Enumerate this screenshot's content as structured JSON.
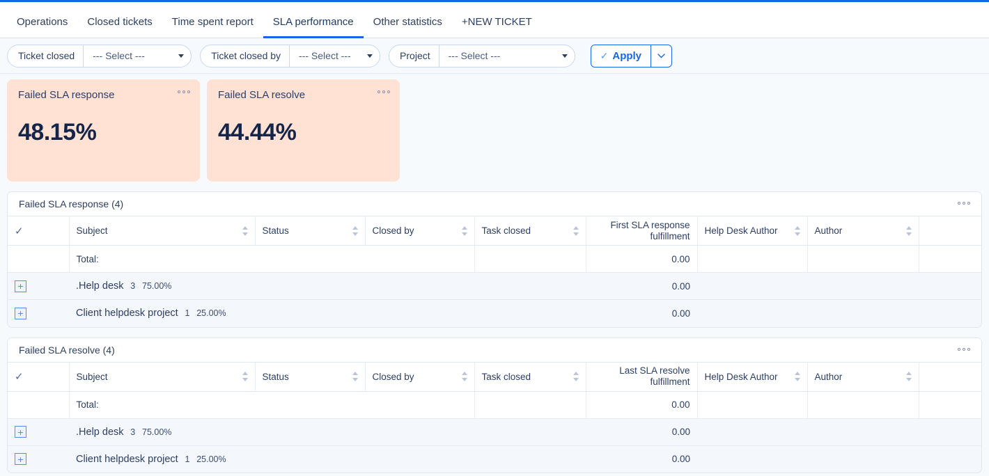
{
  "theme": {
    "accent": "#1566E8",
    "card_bg": "#FFE2D4",
    "page_bg": "#F7FAFD",
    "row_bg": "#F4F7FB",
    "text": "#2C3E63"
  },
  "nav": {
    "tabs": [
      {
        "label": "Operations",
        "active": false
      },
      {
        "label": "Closed tickets",
        "active": false
      },
      {
        "label": "Time spent report",
        "active": false
      },
      {
        "label": "SLA performance",
        "active": true
      },
      {
        "label": "Other statistics",
        "active": false
      },
      {
        "label": "+NEW TICKET",
        "active": false
      }
    ]
  },
  "filters": {
    "groups": [
      {
        "label": "Ticket closed",
        "value": "--- Select ---"
      },
      {
        "label": "Ticket closed by",
        "value": "--- Select ---"
      },
      {
        "label": "Project",
        "value": "--- Select ---"
      }
    ],
    "apply_label": "Apply",
    "apply_check": "✓"
  },
  "cards": [
    {
      "title": "Failed SLA response",
      "value": "48.15%"
    },
    {
      "title": "Failed SLA resolve",
      "value": "44.44%"
    }
  ],
  "panels": [
    {
      "title": "Failed SLA response (4)",
      "columns": [
        "Subject",
        "Status",
        "Closed by",
        "Task closed",
        "First SLA response fulfillment",
        "Help Desk Author",
        "Author"
      ],
      "fulfillment_header_line1": "First SLA response",
      "fulfillment_header_line2": "fulfillment",
      "total_label": "Total:",
      "total_value": "0.00",
      "rows": [
        {
          "expand": "+",
          "name": ".Help desk",
          "count": "3",
          "percent": "75.00%",
          "value": "0.00"
        },
        {
          "expand": "+",
          "name": "Client helpdesk project",
          "count": "1",
          "percent": "25.00%",
          "value": "0.00"
        }
      ]
    },
    {
      "title": "Failed SLA resolve (4)",
      "columns": [
        "Subject",
        "Status",
        "Closed by",
        "Task closed",
        "Last SLA resolve fulfillment",
        "Help Desk Author",
        "Author"
      ],
      "fulfillment_header_line1": "Last SLA resolve",
      "fulfillment_header_line2": "fulfillment",
      "total_label": "Total:",
      "total_value": "0.00",
      "rows": [
        {
          "expand": "+",
          "name": ".Help desk",
          "count": "3",
          "percent": "75.00%",
          "value": "0.00"
        },
        {
          "expand": "+",
          "name": "Client helpdesk project",
          "count": "1",
          "percent": "25.00%",
          "value": "0.00"
        }
      ]
    }
  ]
}
